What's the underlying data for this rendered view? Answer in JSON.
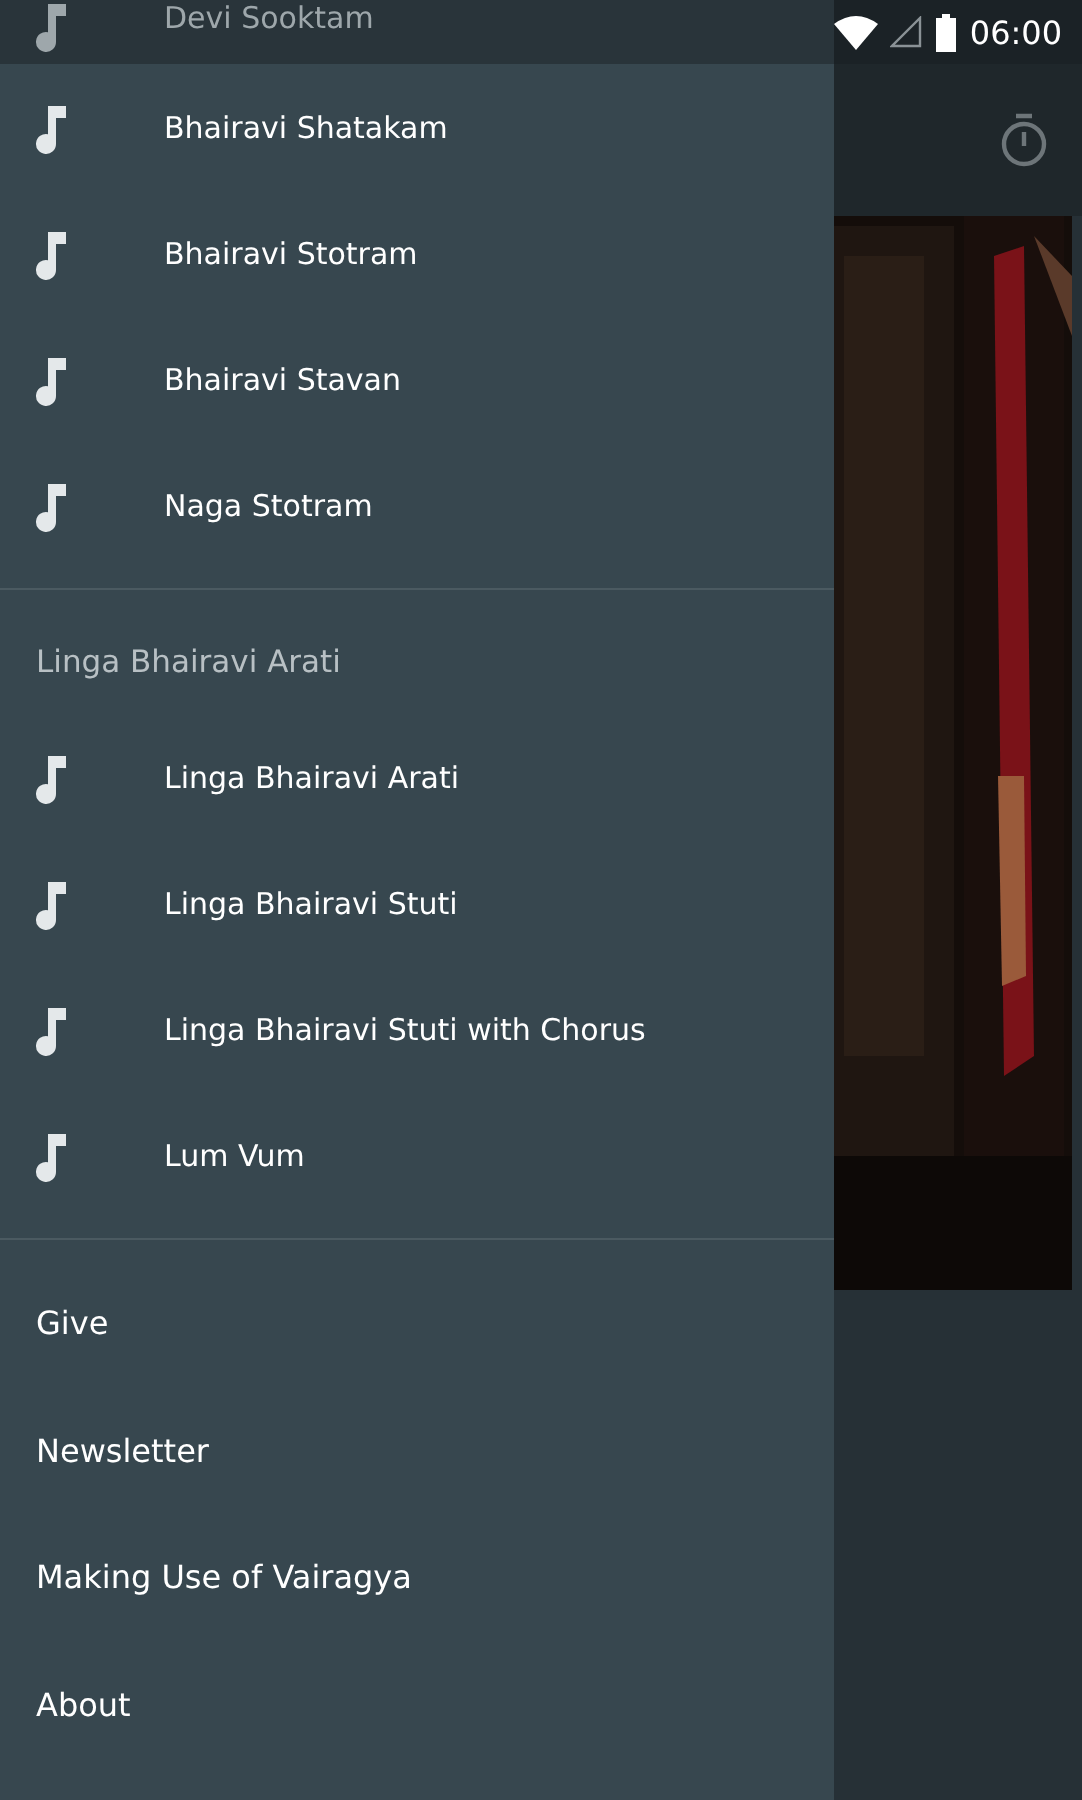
{
  "status_bar": {
    "time": "06:00"
  },
  "drawer": {
    "partial_item": {
      "label": "Devi Sooktam"
    },
    "sections": [
      {
        "items": [
          {
            "label": "Bhairavi Shatakam",
            "kind": "track"
          },
          {
            "label": "Bhairavi Stotram",
            "kind": "track"
          },
          {
            "label": "Bhairavi Stavan",
            "kind": "track"
          },
          {
            "label": "Naga Stotram",
            "kind": "track"
          }
        ]
      },
      {
        "header": "Linga Bhairavi Arati",
        "items": [
          {
            "label": "Linga Bhairavi Arati",
            "kind": "track"
          },
          {
            "label": "Linga Bhairavi Stuti",
            "kind": "track"
          },
          {
            "label": "Linga Bhairavi Stuti with Chorus",
            "kind": "track"
          },
          {
            "label": "Lum Vum",
            "kind": "track"
          }
        ]
      },
      {
        "items": [
          {
            "label": "Give",
            "kind": "link"
          },
          {
            "label": "Newsletter",
            "kind": "link"
          },
          {
            "label": "Making Use of Vairagya",
            "kind": "link"
          },
          {
            "label": "About",
            "kind": "link"
          }
        ]
      }
    ]
  }
}
